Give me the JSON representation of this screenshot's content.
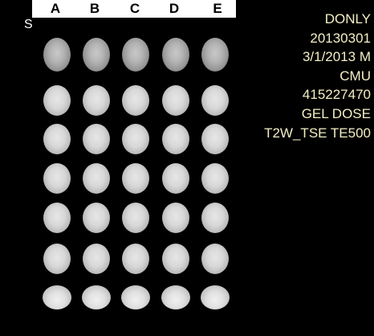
{
  "columns": [
    "A",
    "B",
    "C",
    "D",
    "E"
  ],
  "orientation_label": "S",
  "overlay": {
    "patient_name": "DONLY",
    "study_id": "20130301",
    "study_date_sex": "3/1/2013 M",
    "institution": "CMU",
    "accession": "415227470",
    "description": "GEL DOSE",
    "series": "T2W_TSE TE500"
  },
  "phantom": {
    "rows": 7,
    "cols": 5
  }
}
